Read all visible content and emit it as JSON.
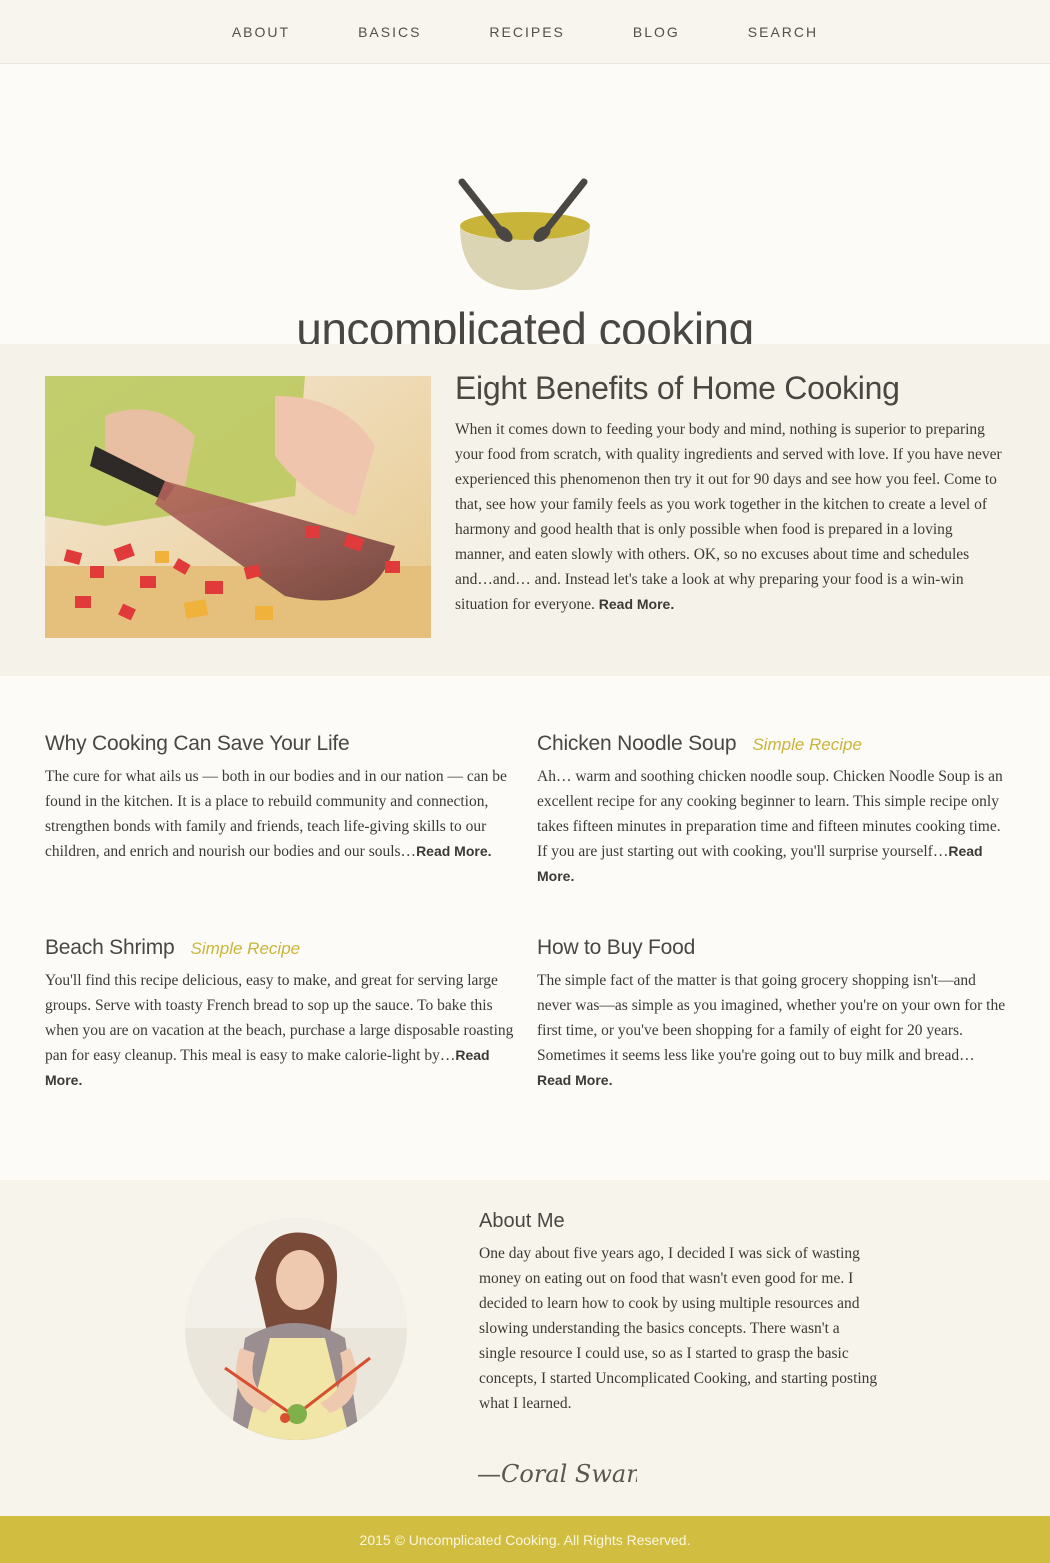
{
  "nav": {
    "items": [
      "ABOUT",
      "BASICS",
      "RECIPES",
      "BLOG",
      "SEARCH"
    ]
  },
  "header": {
    "site_title": "uncomplicated cooking",
    "logo_icon": "salad-bowl-icon"
  },
  "featured": {
    "title": "Eight Benefits of Home Cooking",
    "body": "When it comes down to feeding your body and mind, nothing is superior to preparing your food from scratch, with quality ingredients and served with love. If you have never experienced this phenomenon then try it out for 90 days and see how you feel. Come to that, see how your family feels as you work together in the kitchen to create a level of harmony and good health that is only possible when food is prepared in a loving manner, and eaten slowly with others. OK, so no excuses about time and schedules and…and… and. Instead let's take a look at why preparing your food is a win-win situation for everyone.",
    "read_more": "Read More."
  },
  "posts": [
    {
      "title": "Why Cooking Can Save Your Life",
      "tag": "",
      "body": "The cure for what ails us — both in our bodies and in our nation — can be found in the kitchen. It is a place to rebuild community and connection, strengthen bonds with family and friends, teach life-giving skills to our children, and enrich and nourish our bodies and our souls…",
      "read_more": "Read More."
    },
    {
      "title": "Chicken Noodle Soup",
      "tag": "Simple Recipe",
      "body": "Ah… warm and soothing chicken noodle soup. Chicken Noodle Soup is an excellent recipe for any cooking beginner to learn. This simple recipe only takes fifteen minutes in preparation time and fifteen minutes cooking time. If you are just starting out with cooking, you'll surprise yourself…",
      "read_more": "Read More."
    },
    {
      "title": "Beach Shrimp",
      "tag": "Simple Recipe",
      "body": "You'll find this recipe delicious, easy to make, and great for serving large groups. Serve with toasty French bread to sop up the sauce. To bake this when you are on vacation at the beach, purchase a large disposable roasting pan for easy cleanup. This meal is easy to make calorie-light by…",
      "read_more": "Read More."
    },
    {
      "title": "How to Buy Food",
      "tag": "",
      "body": "The simple fact of the matter is that going grocery shopping isn't—and never was—as simple as you imagined, whether you're on your own for the first time, or you've been shopping for a family of eight for 20 years. Sometimes it seems less like you're going out to buy milk and bread…",
      "read_more": "Read More."
    }
  ],
  "about": {
    "title": "About Me",
    "body": "One day about five years ago, I decided I was sick of wasting money on eating out on food that wasn't even good for me. I decided to learn how to cook by using multiple resources and slowing understanding the basics concepts. There wasn't a single resource I could use, so as I started to grasp the basic concepts, I started Uncomplicated Cooking, and starting posting what I learned.",
    "signature": "—Coral Swan"
  },
  "footer": {
    "text": "2015 © Uncomplicated Cooking. All Rights Reserved."
  },
  "colors": {
    "accent": "#d1bd40",
    "tag": "#c9b43a"
  }
}
